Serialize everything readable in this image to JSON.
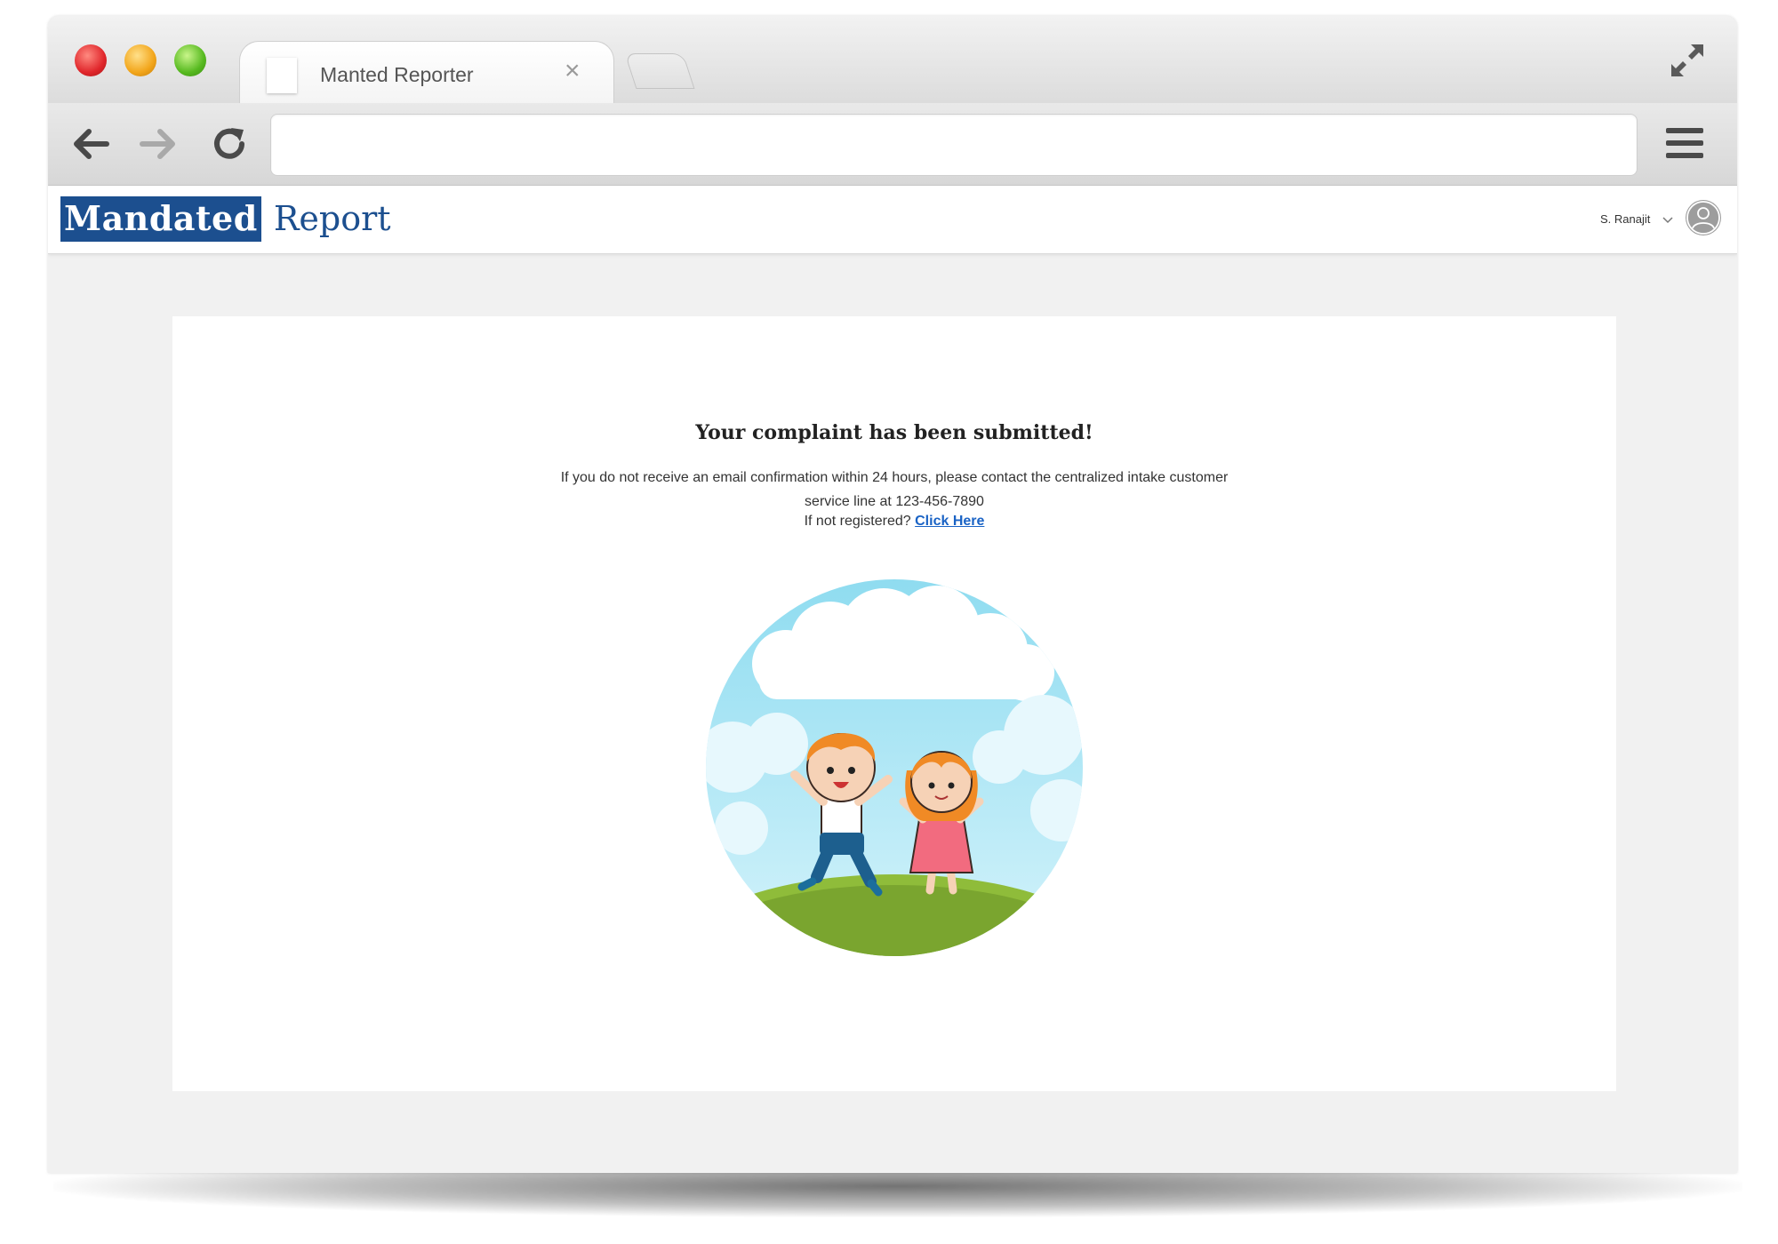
{
  "browser": {
    "tab_title": "Manted Reporter",
    "tab_close": "×",
    "address_value": ""
  },
  "app": {
    "logo_part1": "Mandated",
    "logo_part2": "Report",
    "user_name": "S. Ranajit",
    "brand_color": "#1c4f8f"
  },
  "confirmation": {
    "title": "Your complaint has been submitted!",
    "body": "If you do not receive an email confirmation within 24 hours, please contact the centralized intake customer service line at 123-456-7890",
    "register_prompt": "If not registered?",
    "register_link": "Click Here",
    "link_color": "#1a63c5"
  },
  "icons": {
    "back": "arrow-left-icon",
    "forward": "arrow-right-icon",
    "reload": "reload-icon",
    "menu": "hamburger-menu-icon",
    "fullscreen": "expand-icon",
    "avatar": "user-avatar-icon"
  }
}
